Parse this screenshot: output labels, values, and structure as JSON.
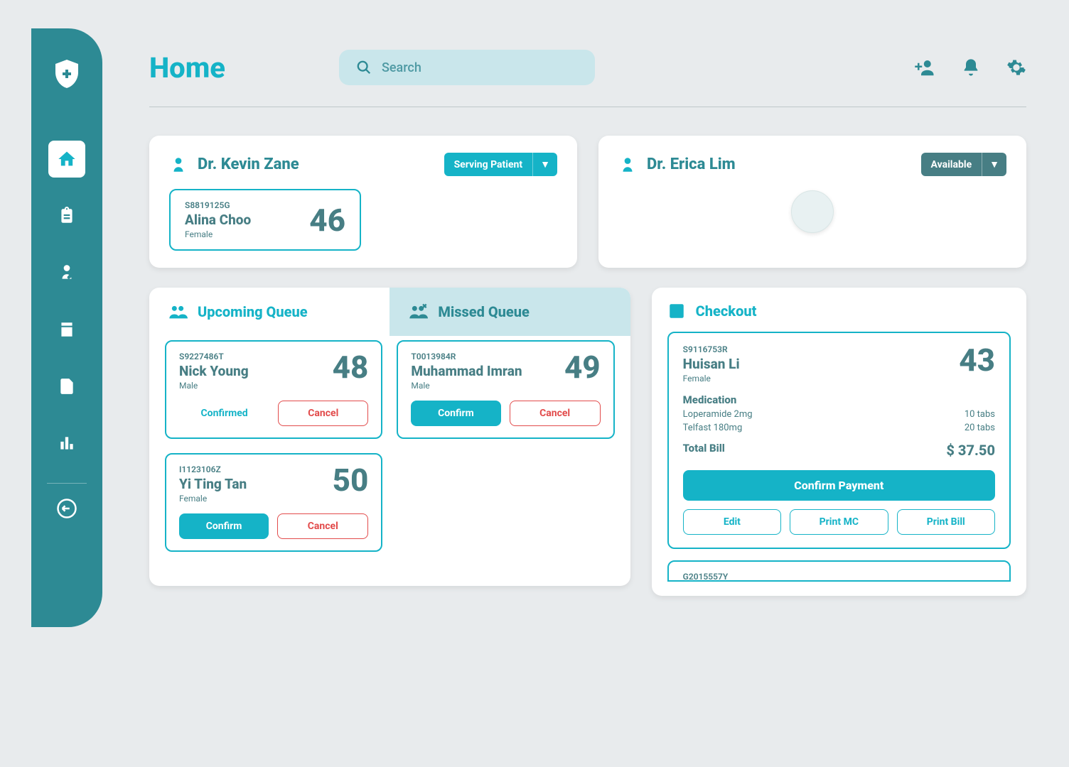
{
  "page_title": "Home",
  "search": {
    "placeholder": "Search"
  },
  "doctors": [
    {
      "name": "Dr. Kevin Zane",
      "status_label": "Serving Patient",
      "status_class": "status-serving",
      "patient": {
        "id": "S8819125G",
        "name": "Alina Choo",
        "gender": "Female",
        "number": "46"
      }
    },
    {
      "name": "Dr. Erica Lim",
      "status_label": "Available",
      "status_class": "status-available"
    }
  ],
  "queue_tabs": {
    "upcoming": "Upcoming Queue",
    "missed": "Missed Queue"
  },
  "upcoming_queue": [
    {
      "id": "S9227486T",
      "name": "Nick Young",
      "gender": "Male",
      "number": "48",
      "confirmed": true
    },
    {
      "id": "I1123106Z",
      "name": "Yi Ting Tan",
      "gender": "Female",
      "number": "50",
      "confirmed": false
    }
  ],
  "missed_queue": [
    {
      "id": "T0013984R",
      "name": "Muhammad Imran",
      "gender": "Male",
      "number": "49",
      "confirmed": false
    }
  ],
  "buttons": {
    "confirmed": "Confirmed",
    "confirm": "Confirm",
    "cancel": "Cancel",
    "confirm_payment": "Confirm Payment",
    "edit": "Edit",
    "print_mc": "Print MC",
    "print_bill": "Print Bill"
  },
  "checkout": {
    "title": "Checkout",
    "patient": {
      "id": "S9116753R",
      "name": "Huisan Li",
      "gender": "Female",
      "number": "43"
    },
    "medication_heading": "Medication",
    "medications": [
      {
        "name": "Loperamide 2mg",
        "qty": "10 tabs"
      },
      {
        "name": "Telfast 180mg",
        "qty": "20 tabs"
      }
    ],
    "total_label": "Total Bill",
    "total_amount": "$ 37.50",
    "next_patient_id": "G2015557Y"
  },
  "colors": {
    "accent": "#15B3C7",
    "dark_teal": "#2D8A94",
    "muted_teal": "#477E84",
    "danger": "#E24B4B"
  }
}
